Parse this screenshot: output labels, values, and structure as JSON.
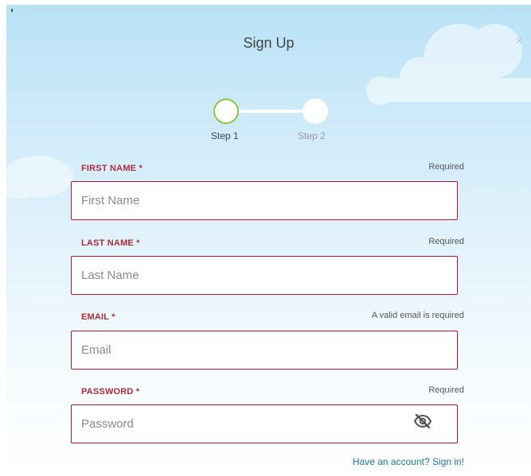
{
  "modal": {
    "title": "Sign Up",
    "close_label": "×"
  },
  "stepper": {
    "steps": [
      {
        "label": "Step 1",
        "active": true
      },
      {
        "label": "Step 2",
        "active": false
      }
    ],
    "active_color": "#8cc63f"
  },
  "form": {
    "fields": [
      {
        "label": "FIRST NAME *",
        "hint": "Required",
        "placeholder": "First Name",
        "value": ""
      },
      {
        "label": "LAST NAME *",
        "hint": "Required",
        "placeholder": "Last Name",
        "value": ""
      },
      {
        "label": "EMAIL *",
        "hint": "A valid email is required",
        "placeholder": "Email",
        "value": ""
      },
      {
        "label": "PASSWORD *",
        "hint": "Required",
        "placeholder": "Password",
        "value": ""
      }
    ],
    "password_toggle_icon": "eye-slash-icon",
    "error_color": "#b5162f"
  },
  "footer": {
    "signin_text": "Have an account? Sign in!"
  },
  "colors": {
    "link": "#1a73a8",
    "sky_top": "#b9e2f6"
  }
}
